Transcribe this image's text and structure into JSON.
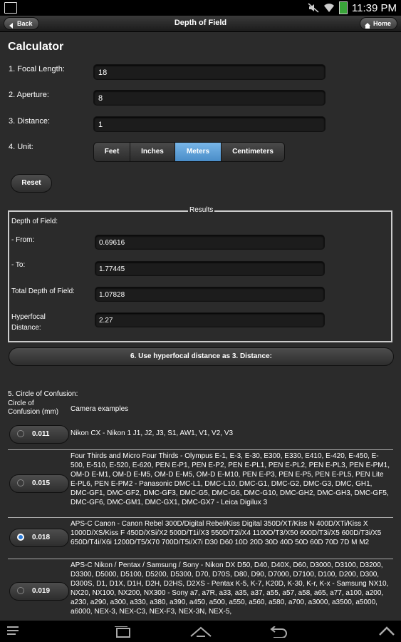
{
  "status": {
    "time": "11:39 PM"
  },
  "header": {
    "back": "Back",
    "title": "Depth of Field",
    "home": "Home"
  },
  "calc": {
    "title": "Calculator",
    "focal_label": "1. Focal Length:",
    "focal_value": "18",
    "aperture_label": "2. Aperture:",
    "aperture_value": "8",
    "distance_label": "3. Distance:",
    "distance_value": "1",
    "unit_label": "4. Unit:",
    "units": [
      "Feet",
      "Inches",
      "Meters",
      "Centimeters"
    ],
    "selected_unit": "Meters",
    "reset": "Reset"
  },
  "results": {
    "legend": "Results",
    "dof_label": "Depth of Field:",
    "from_label": "- From:",
    "from_value": "0.69616",
    "to_label": "- To:",
    "to_value": "1.77445",
    "total_label": "Total Depth of Field:",
    "total_value": "1.07828",
    "hyper_label_1": "Hyperfocal",
    "hyper_label_2": "Distance:",
    "hyper_value": "2.27"
  },
  "use_hyperfocal": "6. Use hyperfocal distance as 3. Distance:",
  "coc": {
    "title": "5. Circle of Confusion:",
    "head_col1_line1": "Circle of",
    "head_col1_line2": "Confusion (mm)",
    "head_col2": "Camera examples",
    "rows": [
      {
        "value": "0.011",
        "selected": false,
        "cameras": "Nikon CX - Nikon 1 J1, J2, J3, S1, AW1, V1, V2, V3"
      },
      {
        "value": "0.015",
        "selected": false,
        "cameras": "Four Thirds and Micro Four Thirds - Olympus E-1, E-3, E-30, E300, E330, E410, E-420, E-450, E-500, E-510, E-520, E-620, PEN E-P1, PEN E-P2, PEN E-PL1, PEN E-PL2, PEN E-PL3, PEN E-PM1, OM-D E-M1, OM-D E-M5, OM-D E-M5, OM-D E-M10, PEN E-P3, PEN E-P5, PEN E-PL5, PEN Lite E-PL6, PEN E-PM2 - Panasonic DMC-L1, DMC-L10, DMC-G1, DMC-G2, DMC-G3, DMC, GH1, DMC-GF1, DMC-GF2, DMC-GF3, DMC-G5, DMC-G6, DMC-G10, DMC-GH2, DMC-GH3, DMC-GF5, DMC-GF6, DMC-GM1, DMC-GX1, DMC-GX7 - Leica Digilux 3"
      },
      {
        "value": "0.018",
        "selected": true,
        "cameras": "APS-C Canon - Canon Rebel 300D/Digital Rebel/Kiss Digital 350D/XT/Kiss N 400D/XTi/Kiss X 1000D/XS/Kiss F 450D/XSi/X2 500D/T1i/X3 550D/T2i/X4 1100D/T3/X50 600D/T3i/X5 600D/T3i/X5 650D/T4i/X6i 1200D/T5/X70 700D/T5i/X7i D30 D60 10D 20D 30D 40D 50D 60D 70D 7D M M2"
      },
      {
        "value": "0.019",
        "selected": false,
        "cameras": "APS-C Nikon / Pentax / Samsung / Sony - Nikon DX D50, D40, D40X, D60, D3000, D3100, D3200, D3300, D5000, D5100, D5200, D5300, D70, D70S, D80, D90, D7000, D7100, D100, D200, D300, D300S, D1, D1X, D1H, D2H, D2HS, D2XS - Pentax K-5, K-7, K20D, K-30, K-r, K-x - Samsung NX10, NX20, NX100, NX200, NX300 - Sony a7, a7R, a33, a35, a37, a55, a57, a58, a65, a77, a100, a200, a230, a290, a300, a330, a380, a390, a450, a500, a550, a560, a580, a700, a3000, a3500, a5000, a6000, NEX-3, NEX-C3, NEX-F3, NEX-3N, NEX-5,"
      }
    ]
  }
}
